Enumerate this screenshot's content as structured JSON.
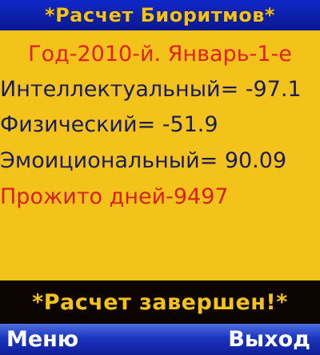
{
  "header": {
    "title": "*Расчет Биоритмов*"
  },
  "main": {
    "date": "Год-2010-й. Январь-1-е",
    "intellectual": "Интеллектуальный= -97.1",
    "physical": "Физический= -51.9",
    "emotional": "Эмоициональный= 90.09",
    "days_lived": "Прожито дней-9497"
  },
  "status": {
    "message": "*Расчет завершен!*"
  },
  "softkeys": {
    "left": "Меню",
    "right": "Выход"
  },
  "colors": {
    "background": "#f3c21b",
    "title_bar": "#1028c8",
    "status_bar": "#0b0400",
    "softkey_bar": "#1c35c0",
    "text_blue": "#1a1c5a",
    "text_red": "#d8201a"
  }
}
